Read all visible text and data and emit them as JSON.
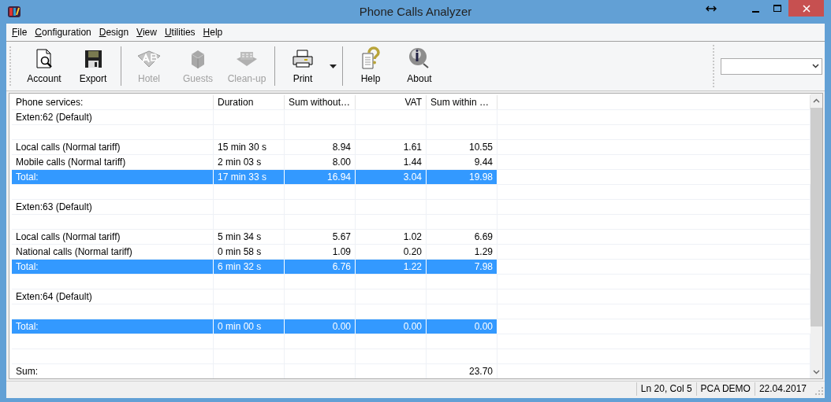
{
  "window": {
    "title": "Phone Calls Analyzer"
  },
  "menu": [
    {
      "label": "File"
    },
    {
      "label": "Configuration"
    },
    {
      "label": "Design"
    },
    {
      "label": "View"
    },
    {
      "label": "Utilities"
    },
    {
      "label": "Help"
    }
  ],
  "toolbar": {
    "groups": [
      [
        {
          "label": "Account",
          "disabled": false
        },
        {
          "label": "Export",
          "disabled": false
        }
      ],
      [
        {
          "label": "Hotel",
          "disabled": true
        },
        {
          "label": "Guests",
          "disabled": true
        },
        {
          "label": "Clean-up",
          "disabled": true
        }
      ],
      [
        {
          "label": "Print",
          "disabled": false,
          "dropdown": true
        }
      ],
      [
        {
          "label": "Help",
          "disabled": false
        },
        {
          "label": "About",
          "disabled": false
        }
      ]
    ]
  },
  "table": {
    "columns": [
      {
        "label": "Phone services:"
      },
      {
        "label": "Duration"
      },
      {
        "label": "Sum without…"
      },
      {
        "label": "VAT"
      },
      {
        "label": "Sum within …"
      }
    ],
    "rows": [
      {
        "kind": "group",
        "cells": [
          "Exten:62  (Default)"
        ]
      },
      {
        "kind": "blank",
        "cells": []
      },
      {
        "kind": "item",
        "cells": [
          "Local calls (Normal tariff)",
          "15 min 30 s",
          "8.94",
          "1.61",
          "10.55"
        ]
      },
      {
        "kind": "item",
        "cells": [
          "Mobile calls (Normal tariff)",
          "2 min 03 s",
          "8.00",
          "1.44",
          "9.44"
        ]
      },
      {
        "kind": "total",
        "cells": [
          "Total:",
          "17 min 33 s",
          "16.94",
          "3.04",
          "19.98"
        ]
      },
      {
        "kind": "blank",
        "cells": []
      },
      {
        "kind": "group",
        "cells": [
          "Exten:63  (Default)"
        ]
      },
      {
        "kind": "blank",
        "cells": []
      },
      {
        "kind": "item",
        "cells": [
          "Local calls (Normal tariff)",
          "5 min 34 s",
          "5.67",
          "1.02",
          "6.69"
        ]
      },
      {
        "kind": "item",
        "cells": [
          "National calls (Normal tariff)",
          "0 min 58 s",
          "1.09",
          "0.20",
          "1.29"
        ]
      },
      {
        "kind": "total",
        "cells": [
          "Total:",
          "6 min 32 s",
          "6.76",
          "1.22",
          "7.98"
        ]
      },
      {
        "kind": "blank",
        "cells": []
      },
      {
        "kind": "group",
        "cells": [
          "Exten:64  (Default)"
        ]
      },
      {
        "kind": "blank",
        "cells": []
      },
      {
        "kind": "total",
        "cells": [
          "Total:",
          "0 min 00 s",
          "0.00",
          "0.00",
          "0.00"
        ]
      },
      {
        "kind": "blank",
        "cells": []
      },
      {
        "kind": "blank",
        "cells": []
      },
      {
        "kind": "sum",
        "label": "Sum:",
        "total": "23.70"
      }
    ]
  },
  "status_bar": [
    "Ln 20, Col 5",
    "PCA DEMO",
    "22.04.2017"
  ]
}
